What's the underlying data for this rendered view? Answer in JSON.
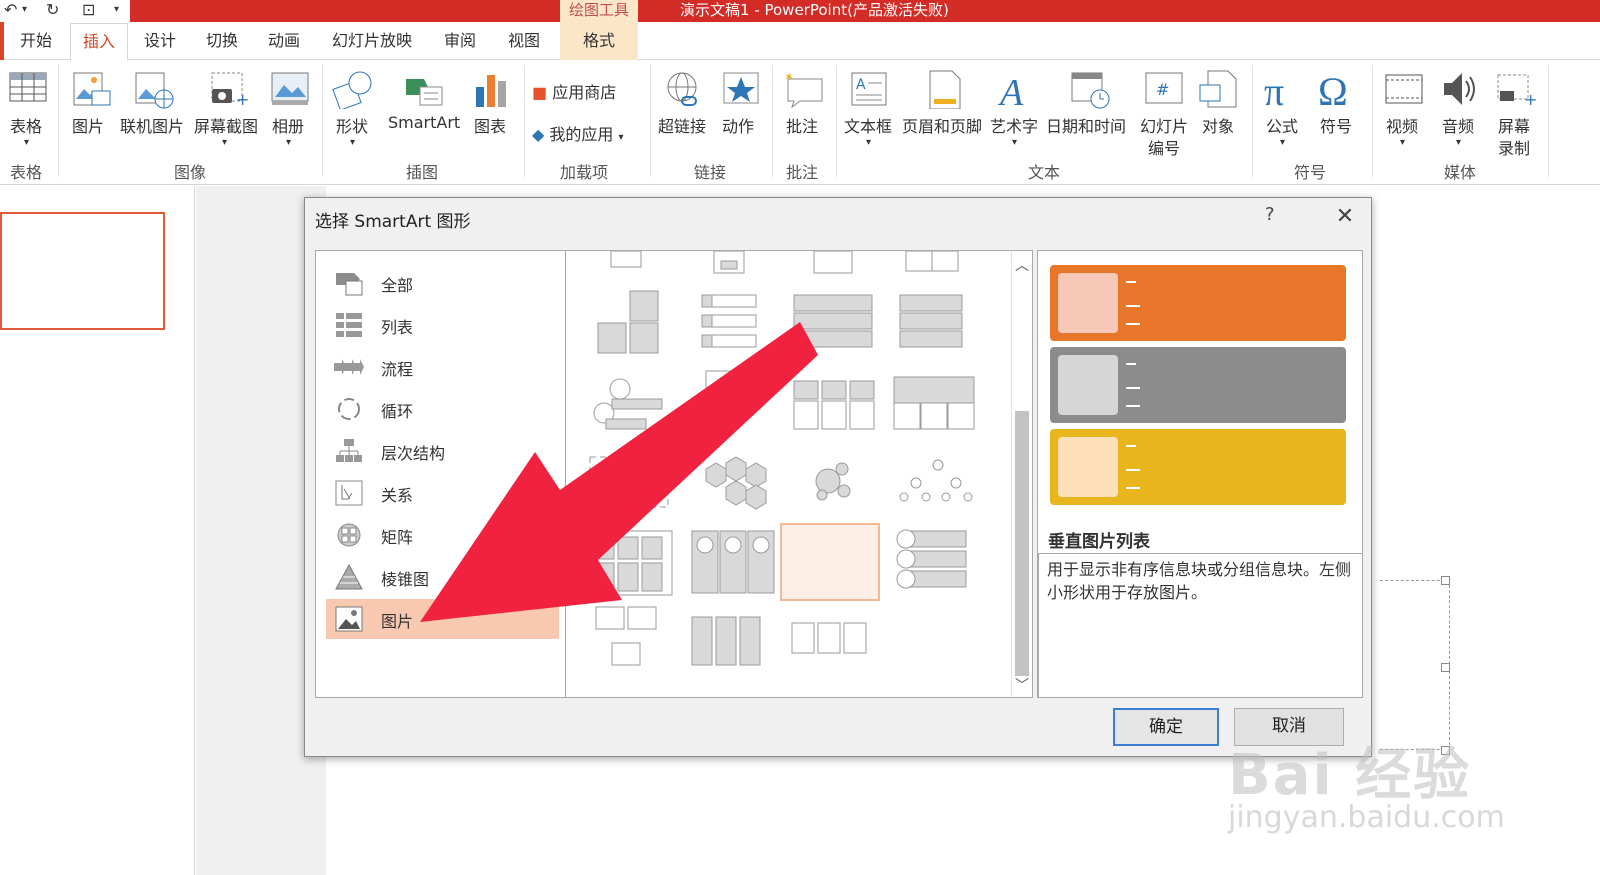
{
  "titlebar": {
    "contextual_tab_group": "绘图工具",
    "window_title": "演示文稿1 - PowerPoint(产品激活失败)"
  },
  "tabs": {
    "home": "开始",
    "insert": "插入",
    "design": "设计",
    "transitions": "切换",
    "animations": "动画",
    "slideshow": "幻灯片放映",
    "review": "审阅",
    "view": "视图",
    "format": "格式"
  },
  "ribbon": {
    "table": "表格",
    "picture": "图片",
    "online_picture": "联机图片",
    "screenshot": "屏幕截图",
    "album": "相册",
    "shapes": "形状",
    "smartart": "SmartArt",
    "chart": "图表",
    "store": "应用商店",
    "my_apps": "我的应用",
    "hyperlink": "超链接",
    "action": "动作",
    "comment": "批注",
    "textbox": "文本框",
    "header_footer": "页眉和页脚",
    "wordart": "艺术字",
    "datetime": "日期和时间",
    "slide_number_1": "幻灯片",
    "slide_number_2": "编号",
    "object": "对象",
    "equation": "公式",
    "symbol": "符号",
    "video": "视频",
    "audio": "音频",
    "screen_rec_1": "屏幕",
    "screen_rec_2": "录制",
    "groups": {
      "tables": "表格",
      "images": "图像",
      "illustrations": "插图",
      "addins": "加载项",
      "links": "链接",
      "comments": "批注",
      "text": "文本",
      "symbols": "符号",
      "media": "媒体"
    }
  },
  "dialog": {
    "title": "选择 SmartArt 图形",
    "help": "?",
    "categories": [
      "全部",
      "列表",
      "流程",
      "循环",
      "层次结构",
      "关系",
      "矩阵",
      "棱锥图",
      "图片"
    ],
    "selected_category": "图片",
    "preview_title": "垂直图片列表",
    "preview_description": "用于显示非有序信息块或分组信息块。左侧小形状用于存放图片。",
    "ok": "确定",
    "cancel": "取消",
    "colors": {
      "orange": "#e8762a",
      "gray": "#8c8c8c",
      "gold": "#e9b51c",
      "selected_category_bg": "#f9c8b0"
    }
  },
  "watermark": {
    "brand": "Bai 经验",
    "url": "jingyan.baidu.com"
  },
  "annotation": {
    "arrow_color": "#f0223f"
  }
}
